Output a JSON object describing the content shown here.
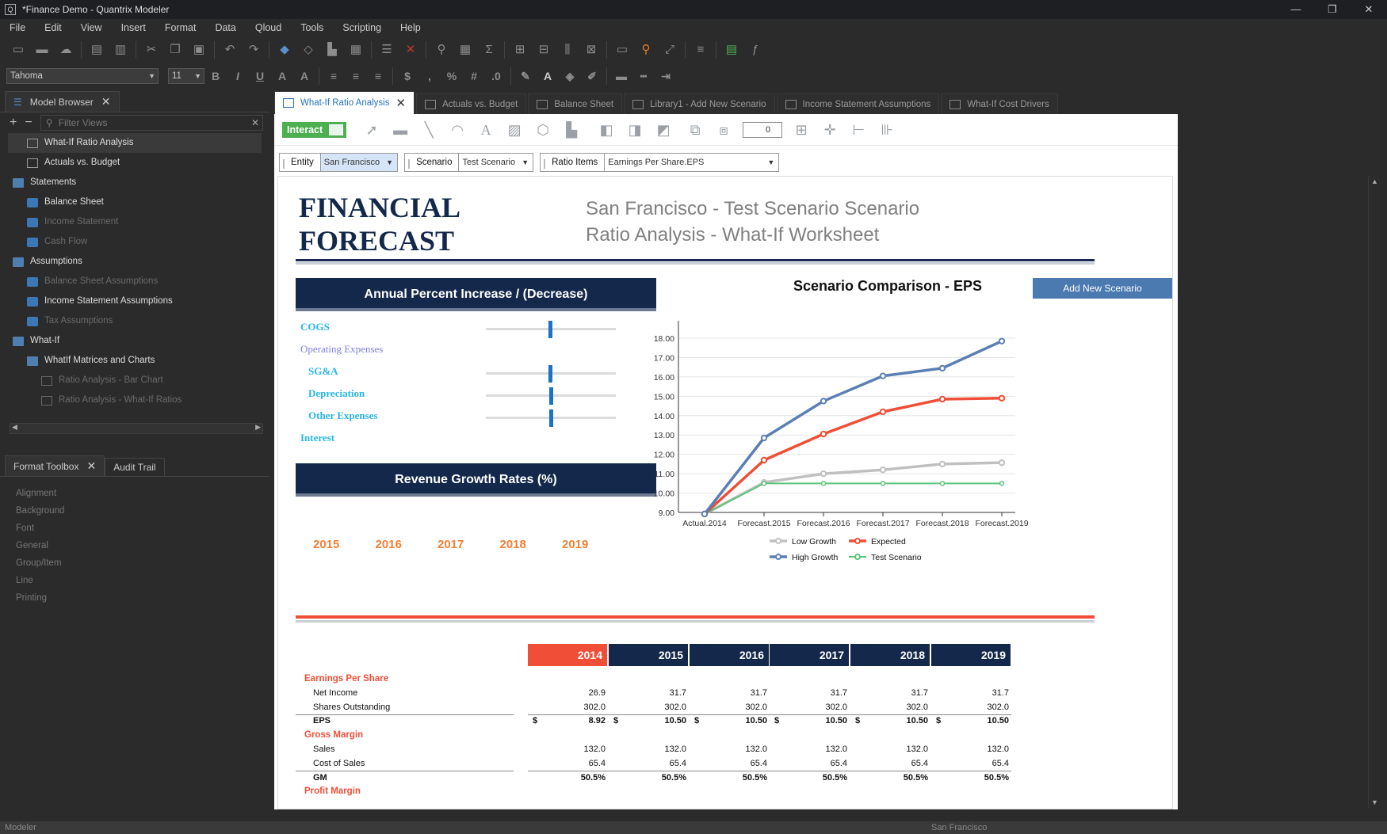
{
  "window": {
    "title": "*Finance Demo - Quantrix Modeler",
    "min": "—",
    "max": "❐",
    "close": "✕"
  },
  "menu": [
    "File",
    "Edit",
    "View",
    "Insert",
    "Format",
    "Data",
    "Qloud",
    "Tools",
    "Scripting",
    "Help"
  ],
  "font_toolbar": {
    "font": "Tahoma",
    "size": "11"
  },
  "model_browser": {
    "tab": "Model Browser",
    "filter_placeholder": "Filter Views",
    "items": [
      {
        "label": "What-If Ratio Analysis",
        "icon": "grid",
        "dim": false,
        "indent": 1
      },
      {
        "label": "Actuals vs. Budget",
        "icon": "grid",
        "dim": false,
        "indent": 1
      },
      {
        "label": "Statements",
        "icon": "folder",
        "dim": false,
        "indent": 0
      },
      {
        "label": "Balance Sheet",
        "icon": "cube",
        "dim": false,
        "indent": 1
      },
      {
        "label": "Income Statement",
        "icon": "cube",
        "dim": true,
        "indent": 1
      },
      {
        "label": "Cash Flow",
        "icon": "cube",
        "dim": true,
        "indent": 1
      },
      {
        "label": "Assumptions",
        "icon": "folder",
        "dim": false,
        "indent": 0
      },
      {
        "label": "Balance Sheet Assumptions",
        "icon": "cube",
        "dim": true,
        "indent": 1
      },
      {
        "label": "Income Statement Assumptions",
        "icon": "cube",
        "dim": false,
        "indent": 1
      },
      {
        "label": "Tax Assumptions",
        "icon": "cube",
        "dim": true,
        "indent": 1
      },
      {
        "label": "What-If",
        "icon": "folder",
        "dim": false,
        "indent": 0
      },
      {
        "label": "WhatIf Matrices and Charts",
        "icon": "folder",
        "dim": false,
        "indent": 1
      },
      {
        "label": "Ratio Analysis - Bar Chart",
        "icon": "dimgrid",
        "dim": true,
        "indent": 2
      },
      {
        "label": "Ratio Analysis - What-If Ratios",
        "icon": "dimgrid",
        "dim": true,
        "indent": 2
      }
    ]
  },
  "format_toolbox": {
    "tabs": [
      "Format Toolbox",
      "Audit Trail"
    ],
    "items": [
      "Alignment",
      "Background",
      "Font",
      "General",
      "Group/Item",
      "Line",
      "Printing"
    ]
  },
  "doc_tabs": [
    {
      "label": "What-If Ratio Analysis",
      "active": true
    },
    {
      "label": "Actuals vs. Budget",
      "active": false
    },
    {
      "label": "Balance Sheet",
      "active": false
    },
    {
      "label": "Library1 - Add New Scenario",
      "active": false
    },
    {
      "label": "Income Statement Assumptions",
      "active": false
    },
    {
      "label": "What-If Cost Drivers",
      "active": false
    }
  ],
  "canvas_toolbar": {
    "interact": "Interact",
    "step_value": "0"
  },
  "selectors": [
    {
      "label": "Entity",
      "value": "San Francisco"
    },
    {
      "label": "Scenario",
      "value": "Test Scenario"
    },
    {
      "label": "Ratio Items",
      "value": "Earnings Per Share.EPS"
    }
  ],
  "report": {
    "title_line1": "FINANCIAL",
    "title_line2": "FORECAST",
    "subtitle_line1": "San Francisco - Test Scenario Scenario",
    "subtitle_line2": "Ratio Analysis - What-If Worksheet",
    "annual_header": "Annual Percent Increase / (Decrease)",
    "sliders": [
      {
        "label": "COGS",
        "value": 0.48,
        "has_slider": true
      },
      {
        "label": "Operating Expenses",
        "has_slider": false
      },
      {
        "label": "SG&A",
        "value": 0.48,
        "has_slider": true
      },
      {
        "label": "Depreciation",
        "value": 0.49,
        "has_slider": true
      },
      {
        "label": "Other Expenses",
        "value": 0.49,
        "has_slider": true
      },
      {
        "label": "Interest",
        "has_slider": false
      }
    ],
    "revenue_header": "Revenue Growth Rates (%)",
    "revenue_years": [
      "2015",
      "2016",
      "2017",
      "2018",
      "2019"
    ],
    "add_button": "Add New Scenario"
  },
  "chart_data": {
    "type": "line",
    "title": "Scenario Comparison - EPS",
    "categories": [
      "Actual.2014",
      "Forecast.2015",
      "Forecast.2016",
      "Forecast.2017",
      "Forecast.2018",
      "Forecast.2019"
    ],
    "ylim": [
      9.0,
      18.0
    ],
    "yticks": [
      "9.00",
      "10.00",
      "11.00",
      "12.00",
      "13.00",
      "14.00",
      "15.00",
      "16.00",
      "17.00",
      "18.00"
    ],
    "grid": true,
    "legend_position": "bottom",
    "series": [
      {
        "name": "Low Growth",
        "color": "#c0c0c0",
        "values": [
          8.92,
          10.55,
          11.0,
          11.2,
          11.5,
          11.57
        ]
      },
      {
        "name": "Expected",
        "color": "#f04e36",
        "values": [
          8.92,
          11.7,
          13.05,
          14.2,
          14.85,
          14.9
        ]
      },
      {
        "name": "High Growth",
        "color": "#5b7fb4",
        "values": [
          8.92,
          12.85,
          14.75,
          16.05,
          16.45,
          17.85
        ]
      },
      {
        "name": "Test Scenario",
        "color": "#5ec47a",
        "values": [
          8.92,
          10.5,
          10.5,
          10.5,
          10.5,
          10.5
        ]
      }
    ]
  },
  "table": {
    "years": [
      "2014",
      "2015",
      "2016",
      "2017",
      "2018",
      "2019"
    ],
    "rows": [
      {
        "type": "section",
        "label": "Earnings Per Share"
      },
      {
        "type": "row",
        "label": "Net Income",
        "values": [
          "26.9",
          "31.7",
          "31.7",
          "31.7",
          "31.7",
          "31.7"
        ]
      },
      {
        "type": "row",
        "label": "Shares Outstanding",
        "values": [
          "302.0",
          "302.0",
          "302.0",
          "302.0",
          "302.0",
          "302.0"
        ]
      },
      {
        "type": "total",
        "label": "EPS",
        "currency": "$",
        "values": [
          "8.92",
          "10.50",
          "10.50",
          "10.50",
          "10.50",
          "10.50"
        ]
      },
      {
        "type": "section",
        "label": "Gross Margin"
      },
      {
        "type": "row",
        "label": "Sales",
        "values": [
          "132.0",
          "132.0",
          "132.0",
          "132.0",
          "132.0",
          "132.0"
        ]
      },
      {
        "type": "row",
        "label": "Cost of Sales",
        "values": [
          "65.4",
          "65.4",
          "65.4",
          "65.4",
          "65.4",
          "65.4"
        ]
      },
      {
        "type": "total",
        "label": "GM",
        "values": [
          "50.5%",
          "50.5%",
          "50.5%",
          "50.5%",
          "50.5%",
          "50.5%"
        ]
      },
      {
        "type": "section",
        "label": "Profit Margin"
      }
    ]
  },
  "status": {
    "left": "Modeler",
    "right": "San Francisco"
  }
}
